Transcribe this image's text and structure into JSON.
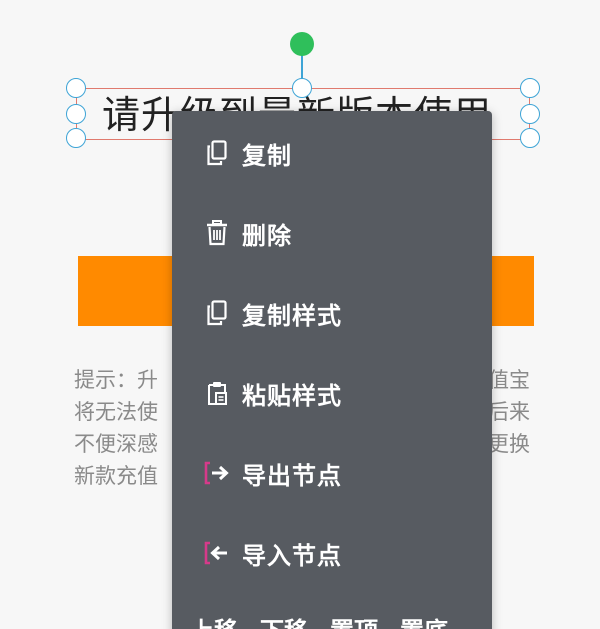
{
  "canvas": {
    "title_text": "请升级到最新版本使用",
    "hint_lines": [
      {
        "left": "提示：升",
        "right": "值宝"
      },
      {
        "left": "将无法使",
        "right": "后来"
      },
      {
        "left": "不便深感",
        "right": "更换"
      },
      {
        "left": "新款充值",
        "right": ""
      }
    ],
    "colors": {
      "button": "#ff8a00",
      "rotate_handle": "#2fbf5b",
      "selection_handle": "#3ea4d6",
      "selection_border": "#e07a6e",
      "menu_bg": "#575b61"
    }
  },
  "context_menu": {
    "items": [
      {
        "label": "复制",
        "icon": "copy-icon"
      },
      {
        "label": "删除",
        "icon": "trash-icon"
      },
      {
        "label": "复制样式",
        "icon": "copy-style-icon"
      },
      {
        "label": "粘贴样式",
        "icon": "paste-style-icon"
      },
      {
        "label": "导出节点",
        "icon": "export-icon"
      },
      {
        "label": "导入节点",
        "icon": "import-icon"
      }
    ],
    "bottom_actions": [
      "上移",
      "下移",
      "置顶",
      "置底"
    ]
  }
}
